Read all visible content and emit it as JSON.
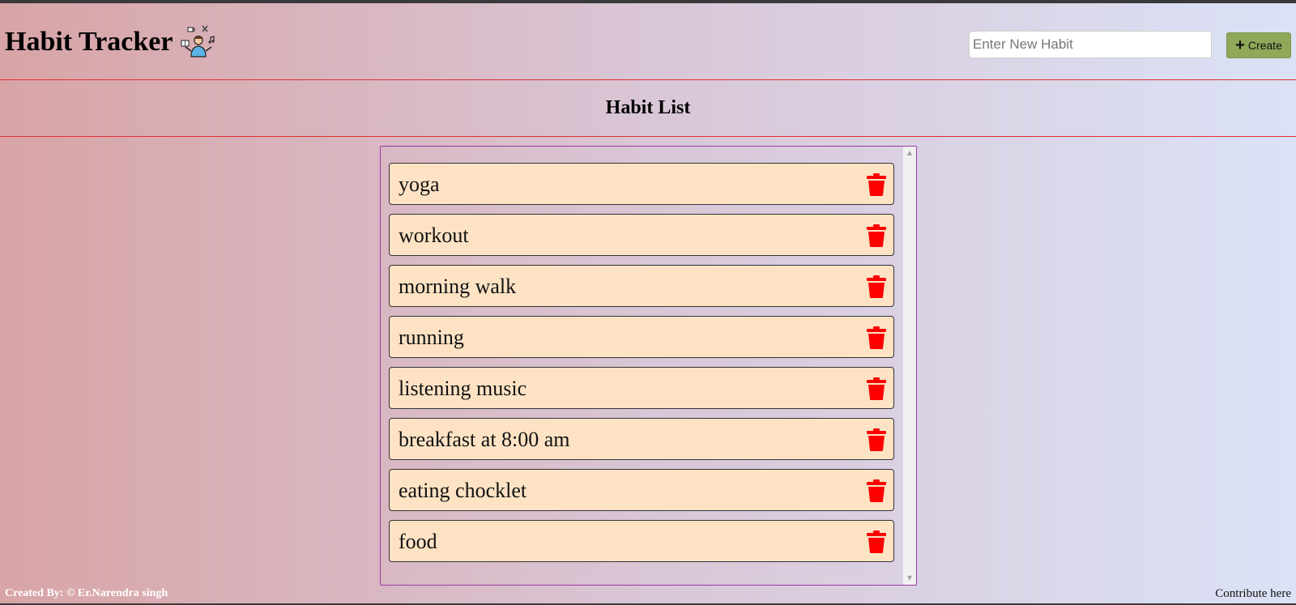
{
  "header": {
    "title": "Habit Tracker",
    "logo_icon": "person-juggling-hobbies-icon"
  },
  "new_habit": {
    "placeholder": "Enter New Habit",
    "value": "",
    "create_label": "Create"
  },
  "list": {
    "title": "Habit List",
    "items": [
      {
        "label": "yoga"
      },
      {
        "label": "workout"
      },
      {
        "label": "morning walk"
      },
      {
        "label": "running"
      },
      {
        "label": "listening music"
      },
      {
        "label": "breakfast at 8:00 am"
      },
      {
        "label": "eating chocklet"
      },
      {
        "label": "food"
      }
    ]
  },
  "footer": {
    "credit": "Created By: © Er.Narendra singh",
    "contribute": "Contribute here"
  },
  "colors": {
    "item_bg": "#fde3c4",
    "delete_icon": "#ff0000",
    "create_button": "#8fa85a",
    "divider": "#e03030"
  }
}
